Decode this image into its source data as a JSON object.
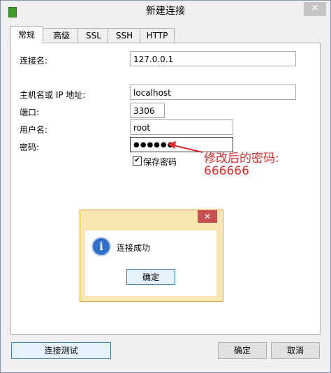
{
  "window": {
    "title": "新建连接",
    "close_glyph": "✕"
  },
  "tabs": [
    {
      "label": "常规",
      "active": true
    },
    {
      "label": "高级"
    },
    {
      "label": "SSL"
    },
    {
      "label": "SSH"
    },
    {
      "label": "HTTP"
    }
  ],
  "form": {
    "connection_name_label": "连接名:",
    "connection_name_value": "127.0.0.1",
    "host_label": "主机名或 IP 地址:",
    "host_value": "localhost",
    "port_label": "端口:",
    "port_value": "3306",
    "user_label": "用户名:",
    "user_value": "root",
    "password_label": "密码:",
    "password_value": "●●●●●●",
    "save_password_label": "保存密码",
    "save_password_checked": true,
    "check_glyph": "✔"
  },
  "annotation": {
    "line1": "修改后的密码:",
    "line2": "666666",
    "color": "#e32c2c"
  },
  "dialog": {
    "close_glyph": "✕",
    "icon": "info-icon",
    "icon_glyph": "i",
    "message": "连接成功",
    "ok_label": "确定"
  },
  "footer": {
    "test_label": "连接测试",
    "ok_label": "确定",
    "cancel_label": "取消"
  }
}
